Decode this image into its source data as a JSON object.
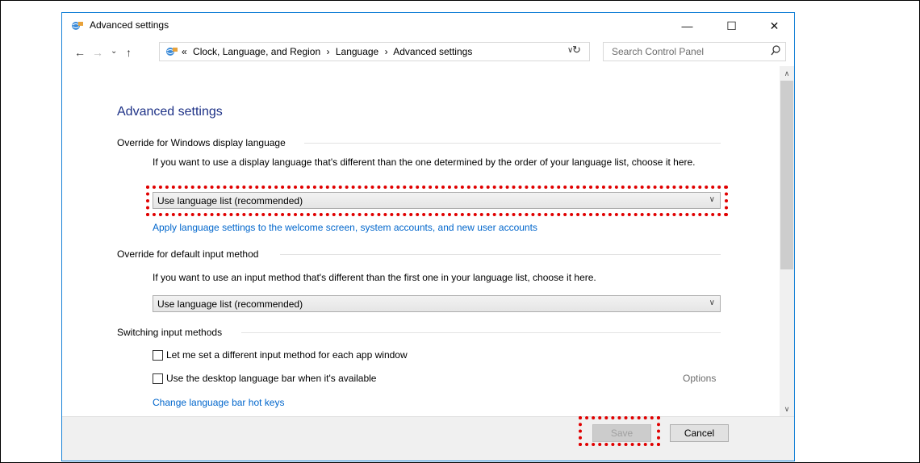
{
  "window": {
    "title": "Advanced settings"
  },
  "window_controls": {
    "minimize": "—",
    "maximize": "☐",
    "close": "✕"
  },
  "nav": {
    "back": "←",
    "forward": "→",
    "recent": "⌄",
    "up": "↑",
    "breadcrumb": {
      "prefix": "«",
      "items": [
        "Clock, Language, and Region",
        "Language",
        "Advanced settings"
      ],
      "separator": "›"
    },
    "search_placeholder": "Search Control Panel"
  },
  "page": {
    "heading": "Advanced settings",
    "display_language": {
      "label": "Override for Windows display language",
      "description": "If you want to use a display language that's different than the one determined by the order of your language list, choose it here.",
      "selected": "Use language list (recommended)",
      "apply_link": "Apply language settings to the welcome screen, system accounts, and new user accounts"
    },
    "input_method": {
      "label": "Override for default input method",
      "description": "If you want to use an input method that's different than the first one in your language list, choose it here.",
      "selected": "Use language list (recommended)"
    },
    "switching": {
      "label": "Switching input methods",
      "checkbox1": "Let me set a different input method for each app window",
      "checkbox2": "Use the desktop language bar when it's available",
      "options_link": "Options",
      "hotkeys_link": "Change language bar hot keys"
    }
  },
  "footer": {
    "save": "Save",
    "cancel": "Cancel"
  },
  "colors": {
    "highlight": "#e00000",
    "link": "#0066cc",
    "heading": "#1e3287"
  }
}
